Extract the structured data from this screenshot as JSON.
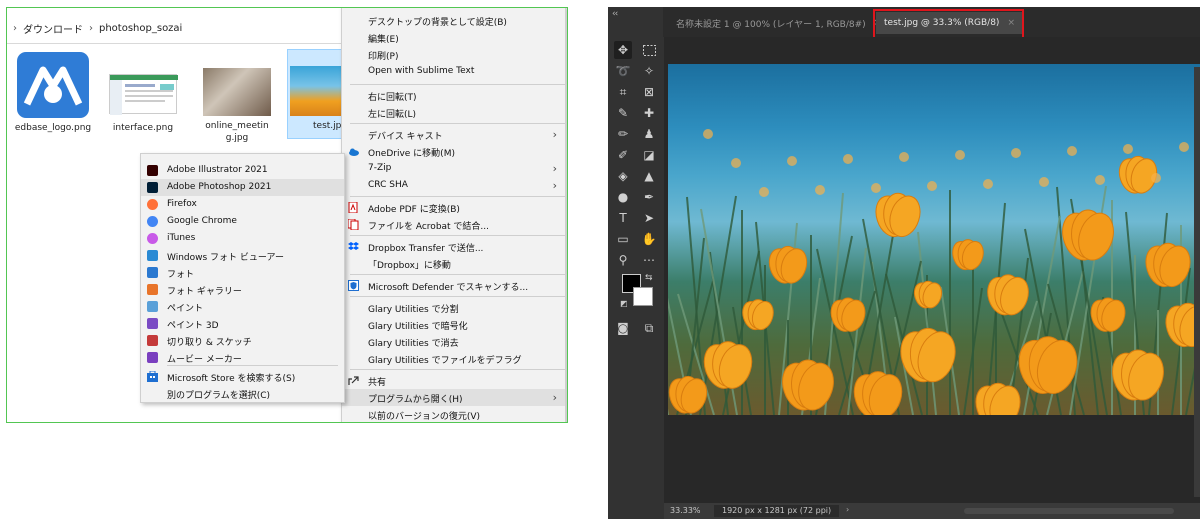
{
  "explorer": {
    "breadcrumb": [
      "ダウンロード",
      "photoshop_sozai"
    ],
    "files": [
      {
        "name": "edbase_logo.png"
      },
      {
        "name": "interface.png"
      },
      {
        "name": "online_meeting.jpg"
      },
      {
        "name": "test.jpg"
      }
    ]
  },
  "open_with_menu": {
    "items": [
      {
        "label": "Adobe Illustrator 2021",
        "icon": "illustrator-icon",
        "color": "#330000"
      },
      {
        "label": "Adobe Photoshop 2021",
        "icon": "photoshop-icon",
        "color": "#001e36"
      },
      {
        "label": "Firefox",
        "icon": "firefox-icon",
        "color": "#ff7139"
      },
      {
        "label": "Google Chrome",
        "icon": "chrome-icon",
        "color": "#4285f4"
      },
      {
        "label": "iTunes",
        "icon": "itunes-icon",
        "color": "#c85ae8"
      },
      {
        "label": "Windows フォト ビューアー",
        "icon": "photo-viewer-icon",
        "color": "#2a8ad4"
      },
      {
        "label": "フォト",
        "icon": "photos-icon",
        "color": "#2b79d0"
      },
      {
        "label": "フォト ギャラリー",
        "icon": "photo-gallery-icon",
        "color": "#e8742a"
      },
      {
        "label": "ペイント",
        "icon": "paint-icon",
        "color": "#5aa0d8"
      },
      {
        "label": "ペイント 3D",
        "icon": "paint3d-icon",
        "color": "#7a4bc4"
      },
      {
        "label": "切り取り & スケッチ",
        "icon": "snip-sketch-icon",
        "color": "#c43a3a"
      },
      {
        "label": "ムービー メーカー",
        "icon": "movie-maker-icon",
        "color": "#7a3fbf"
      }
    ],
    "store_label": "Microsoft Store を検索する(S)",
    "choose_label": "別のプログラムを選択(C)"
  },
  "context_menu": {
    "items": [
      {
        "label": "デスクトップの背景として設定(B)"
      },
      {
        "label": "編集(E)"
      },
      {
        "label": "印刷(P)"
      },
      {
        "label": "Open with Sublime Text"
      },
      {
        "label": "右に回転(T)"
      },
      {
        "label": "左に回転(L)"
      },
      {
        "label": "デバイス キャスト"
      },
      {
        "label": "OneDrive に移動(M)"
      },
      {
        "label": "7-Zip"
      },
      {
        "label": "CRC SHA"
      },
      {
        "label": "Adobe PDF に変換(B)"
      },
      {
        "label": "ファイルを Acrobat で結合..."
      },
      {
        "label": "Dropbox Transfer で送信..."
      },
      {
        "label": "「Dropbox」に移動"
      },
      {
        "label": "Microsoft Defender でスキャンする..."
      },
      {
        "label": "Glary Utilities で分割"
      },
      {
        "label": "Glary Utilities で暗号化"
      },
      {
        "label": "Glary Utilities で消去"
      },
      {
        "label": "Glary Utilities でファイルをデフラグ"
      },
      {
        "label": "共有"
      },
      {
        "label": "プログラムから開く(H)"
      },
      {
        "label": "以前のバージョンの復元(V)"
      }
    ]
  },
  "photoshop": {
    "collapse": "‹‹",
    "tabs": [
      {
        "label": "名称未設定 1 @ 100% (レイヤー 1, RGB/8#)"
      },
      {
        "label": "test.jpg @ 33.3% (RGB/8)"
      }
    ],
    "status": {
      "zoom": "33.33%",
      "dimensions": "1920 px x 1281 px (72 ppi)",
      "arrow": "›"
    },
    "highlight_color": "#e0151c"
  }
}
